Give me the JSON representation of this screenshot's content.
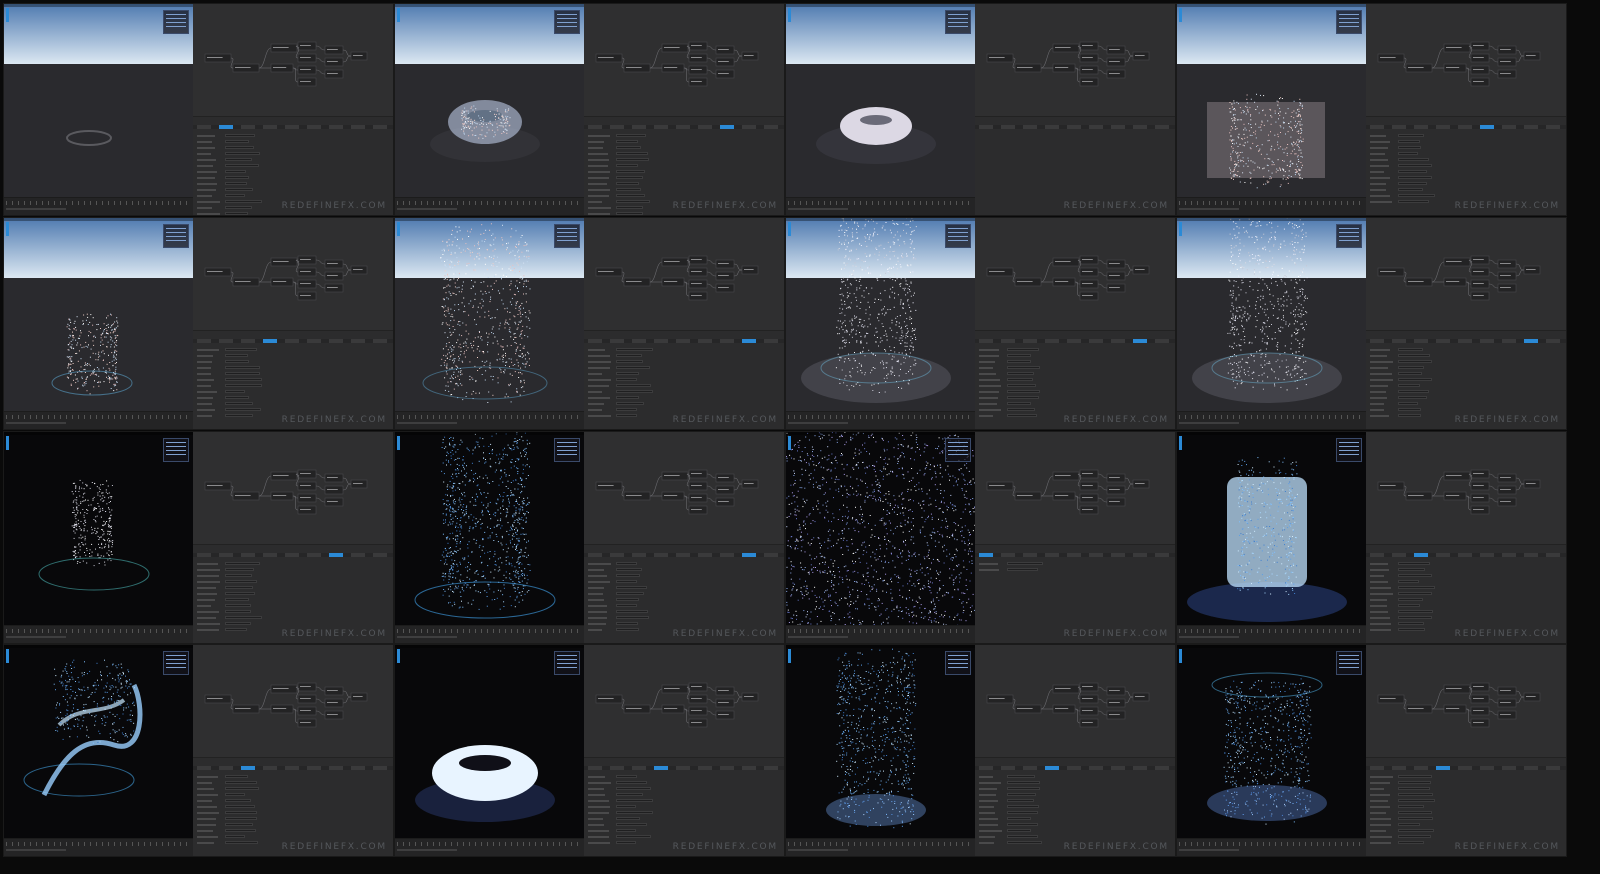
{
  "watermark": "REDEFINEFX.COM",
  "colors": {
    "panel": "#2b2b2c",
    "node_editor": "#2f2f30",
    "accent": "#2b8ad6",
    "sky_top": "#4f7ab0",
    "sky_horizon": "#dce8f2",
    "ground": "#2a2a2e",
    "dark_bg": "#08080a"
  },
  "tiles": [
    {
      "scene": "sky",
      "effect": "ring-faint",
      "props_rows": 14,
      "active_tab": 1
    },
    {
      "scene": "sky",
      "effect": "torus-particles",
      "props_rows": 14,
      "active_tab": 6
    },
    {
      "scene": "sky",
      "effect": "torus-solid",
      "props_rows": 0,
      "active_tab": 0
    },
    {
      "scene": "sky",
      "effect": "cylinder-particles",
      "props_rows": 12,
      "active_tab": 5
    },
    {
      "scene": "sky",
      "effect": "short-cylinder",
      "props_rows": 12,
      "active_tab": 3
    },
    {
      "scene": "sky",
      "effect": "tall-cylinder",
      "props_rows": 12,
      "active_tab": 7
    },
    {
      "scene": "sky",
      "effect": "white-column",
      "props_rows": 12,
      "active_tab": 7
    },
    {
      "scene": "sky",
      "effect": "white-column-thin",
      "props_rows": 12,
      "active_tab": 7
    },
    {
      "scene": "dark",
      "effect": "grey-cylinder",
      "props_rows": 12,
      "active_tab": 6
    },
    {
      "scene": "dark",
      "effect": "blue-cylinder",
      "props_rows": 12,
      "active_tab": 7
    },
    {
      "scene": "dark",
      "effect": "dense-blue",
      "props_rows": 2,
      "active_tab": 0
    },
    {
      "scene": "dark",
      "effect": "glow-cylinder",
      "props_rows": 12,
      "active_tab": 2
    },
    {
      "scene": "dark",
      "effect": "ribbons",
      "props_rows": 12,
      "active_tab": 2
    },
    {
      "scene": "dark",
      "effect": "glow-torus",
      "props_rows": 12,
      "active_tab": 3
    },
    {
      "scene": "dark",
      "effect": "blue-column-ring",
      "props_rows": 12,
      "active_tab": 3
    },
    {
      "scene": "dark",
      "effect": "blue-wave-ring",
      "props_rows": 12,
      "active_tab": 3
    }
  ]
}
